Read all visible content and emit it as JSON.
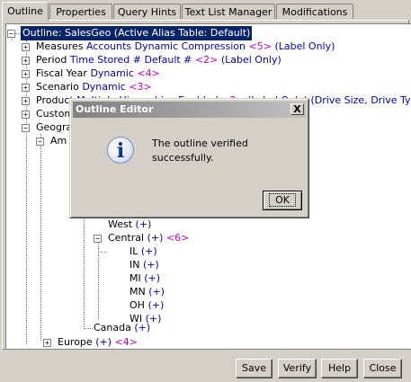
{
  "tabs": [
    {
      "label": "Outline",
      "active": true
    },
    {
      "label": "Properties",
      "active": false
    },
    {
      "label": "Query Hints",
      "active": false
    },
    {
      "label": "Text List Manager",
      "active": false
    },
    {
      "label": "Modifications",
      "active": false
    }
  ],
  "tree": {
    "root": "Outline: SalesGeo (Active Alias Table: Default)",
    "measures": {
      "name": "Measures",
      "props": "Accounts Dynamic  Compression",
      "count": "<5>",
      "extra": "(Label Only)"
    },
    "period": {
      "name": "Period",
      "props": "Time Stored # Default #",
      "count": "<2>",
      "extra": "(Label Only)"
    },
    "fiscal_year": {
      "name": "Fiscal Year",
      "props": "Dynamic",
      "count": "<4>"
    },
    "scenario": {
      "name": "Scenario",
      "props": "Dynamic",
      "count": "<3>"
    },
    "product": {
      "name": "Product",
      "props": "Multiple Hierarchies Enabled",
      "count": "<2>",
      "extra": "(Label Only) (Drive Size, Drive Type, Line Tot"
    },
    "customer": {
      "name": "Custom"
    },
    "geography": {
      "name": "Geograp"
    },
    "americas": {
      "name": "Am"
    },
    "west": {
      "name": "West",
      "props": "(+)"
    },
    "central": {
      "name": "Central",
      "props": "(+)",
      "count": "<6>"
    },
    "states": [
      {
        "name": "IL",
        "props": "(+)"
      },
      {
        "name": "IN",
        "props": "(+)"
      },
      {
        "name": "MI",
        "props": "(+)"
      },
      {
        "name": "MN",
        "props": "(+)"
      },
      {
        "name": "OH",
        "props": "(+)"
      },
      {
        "name": "WI",
        "props": "(+)"
      }
    ],
    "canada": {
      "name": "Canada",
      "props": "(+)"
    },
    "europe": {
      "name": "Europe",
      "props": "(+)",
      "count": "<4>"
    }
  },
  "buttons": {
    "save": "Save",
    "verify": "Verify",
    "help": "Help",
    "close": "Close"
  },
  "dialog": {
    "title": "Outline Editor",
    "close_glyph": "X",
    "icon_glyph": "i",
    "message": "The outline verified successfully.",
    "ok": "OK"
  }
}
